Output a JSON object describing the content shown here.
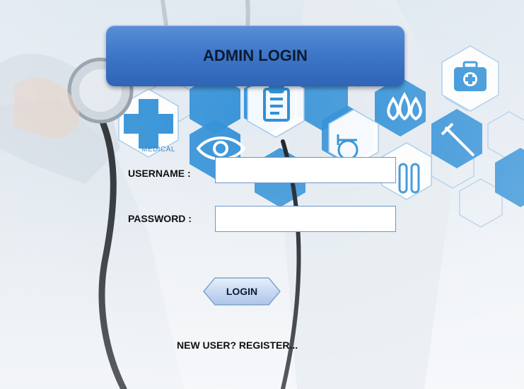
{
  "title": "ADMIN LOGIN",
  "decor": {
    "medical_text": "MEDICAL"
  },
  "form": {
    "username_label": "USERNAME :",
    "username_value": "",
    "password_label": "PASSWORD :",
    "password_value": "",
    "login_button_label": "LOGIN",
    "register_link_text": "NEW USER? REGISTER..."
  },
  "colors": {
    "banner": "#3f78c8",
    "hex_blue": "#2f8fd6",
    "input_border": "#6d97c9"
  },
  "icons": [
    "stethoscope-icon",
    "medical-cross-icon",
    "clipboard-icon",
    "eye-icon",
    "wheelchair-icon",
    "droplets-icon",
    "first-aid-kit-icon",
    "syringe-icon",
    "test-tubes-icon"
  ]
}
